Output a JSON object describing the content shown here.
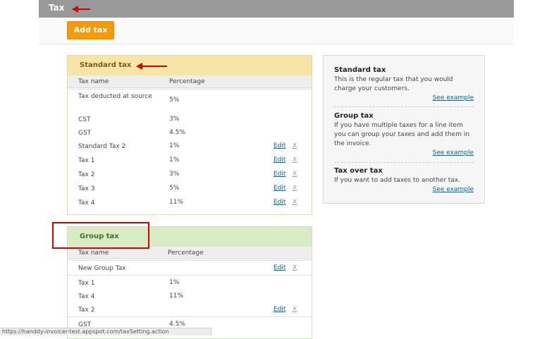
{
  "header": {
    "title": "Tax"
  },
  "toolbar": {
    "add_label": "Add tax"
  },
  "standard": {
    "title": "Standard tax",
    "col_name": "Tax name",
    "col_pct": "Percentage",
    "rows": [
      {
        "name": "Tax deducted at source",
        "pct": "5%"
      },
      {
        "name": "CST",
        "pct": "3%"
      },
      {
        "name": "GST",
        "pct": "4.5%"
      },
      {
        "name": "Standard Tax 2",
        "pct": "1%",
        "edit": "Edit",
        "del": "X"
      },
      {
        "name": "Tax 1",
        "pct": "1%",
        "edit": "Edit",
        "del": "X"
      },
      {
        "name": "Tax 2",
        "pct": "3%",
        "edit": "Edit",
        "del": "X"
      },
      {
        "name": "Tax 3",
        "pct": "5%",
        "edit": "Edit",
        "del": "X"
      },
      {
        "name": "Tax 4",
        "pct": "11%",
        "edit": "Edit",
        "del": "X"
      }
    ]
  },
  "group": {
    "title": "Group tax",
    "col_name": "Tax name",
    "col_pct": "Percentage",
    "rows": [
      {
        "name": "New Group Tax",
        "pct": "",
        "edit": "Edit",
        "del": "X"
      },
      {
        "name": "Tax 1",
        "pct": "1%"
      },
      {
        "name": "Tax 4",
        "pct": "11%"
      },
      {
        "name": "Tax 2",
        "pct": "",
        "edit": "Edit",
        "del": "X"
      },
      {
        "name": "GST",
        "pct": "4.5%"
      }
    ]
  },
  "sidebar": {
    "items": [
      {
        "title": "Standard tax",
        "desc": "This is the regular tax that you would charge your customers.",
        "link": "See example"
      },
      {
        "title": "Group tax",
        "desc": "If you have multiple taxes for a line item you can group your taxes and add them in the invoice.",
        "link": "See example"
      },
      {
        "title": "Tax over tax",
        "desc": "If you want to add taxes to another tax.",
        "link": "See example"
      }
    ]
  },
  "status": {
    "url": "https://handdy-invoicer-test.appspot.com/taxSetting.action"
  },
  "colors": {
    "accent": "#f59a0c",
    "annotation": "#d90000",
    "link": "#0066aa"
  }
}
